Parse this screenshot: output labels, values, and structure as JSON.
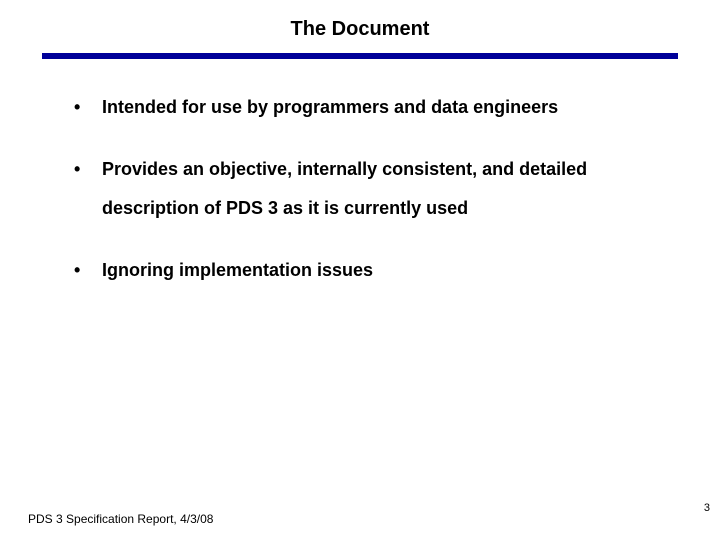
{
  "title": "The Document",
  "bullets": [
    "Intended for use by programmers and data engineers",
    "Provides  an objective, internally consistent, and detailed description of PDS 3 as it is currently used",
    "Ignoring implementation issues"
  ],
  "footer": "PDS 3 Specification Report, 4/3/08",
  "page": "3",
  "accent": "#000099"
}
